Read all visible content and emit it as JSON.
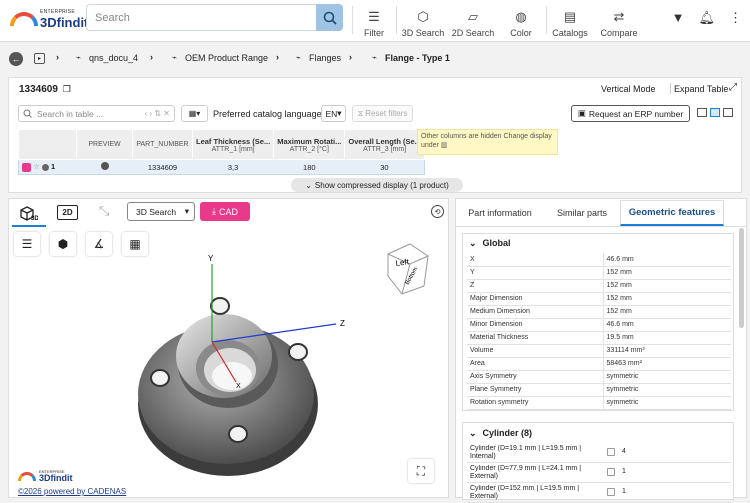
{
  "brand": {
    "enterprise": "ENTERPRISE",
    "name": "3Dfindit"
  },
  "search": {
    "placeholder": "Search"
  },
  "toolbar": {
    "filter": "Filter",
    "search3d": "3D Search",
    "search2d": "2D Search",
    "color": "Color",
    "catalogs": "Catalogs",
    "compare": "Compare"
  },
  "breadcrumb": [
    "qns_docu_4",
    "OEM Product Range",
    "Flanges",
    "Flange - Type 1"
  ],
  "part": {
    "number": "1334609",
    "vertical_mode": "Vertical Mode",
    "expand_table": "Expand Table",
    "search_table_placeholder": "Search in table ...",
    "language_label": "Preferred catalog language",
    "language_value": "EN",
    "reset_filters": "Reset filters",
    "erp_button": "Request an ERP number",
    "hidden_note": "Other columns are hidden Change display under",
    "compressed": "Show compressed display (1 product)"
  },
  "table": {
    "headers": [
      {
        "title": "PREVIEW",
        "sub": ""
      },
      {
        "title": "PART_NUMBER",
        "sub": ""
      },
      {
        "title": "Leaf Thickness (Se...",
        "sub": "ATTR_1 [mm]"
      },
      {
        "title": "Maximum Rotati...",
        "sub": "ATTR_2 [°C]"
      },
      {
        "title": "Overall Length (Se...",
        "sub": "ATTR_3 [mm]"
      }
    ],
    "row": {
      "index": "1",
      "part_number": "1334609",
      "attr1": "3,3",
      "attr2": "180",
      "attr3": "30"
    }
  },
  "viewer": {
    "mode_2d": "2D",
    "search_3d": "3D Search",
    "cad": "CAD",
    "cube_left": "Left",
    "cube_bottom": "Bottom",
    "axis_x": "X",
    "axis_y": "Y",
    "axis_z": "Z",
    "footer_brand": "3Dfindit",
    "footer_enterprise": "ENTERPRISE",
    "powered": "©2026 powered by CADENAS"
  },
  "info_tabs": [
    "Part information",
    "Similar parts",
    "Geometric features"
  ],
  "global": {
    "title": "Global",
    "rows": [
      [
        "X",
        "46.6 mm"
      ],
      [
        "Y",
        "152 mm"
      ],
      [
        "Z",
        "152 mm"
      ],
      [
        "Major Dimension",
        "152 mm"
      ],
      [
        "Medium Dimension",
        "152 mm"
      ],
      [
        "Minor Dimension",
        "46.6 mm"
      ],
      [
        "Material Thickness",
        "19.5 mm"
      ],
      [
        "Volume",
        "331114 mm³"
      ],
      [
        "Area",
        "58463 mm²"
      ],
      [
        "Axis Symmetry",
        "symmetric"
      ],
      [
        "Plane Symmetry",
        "symmetric"
      ],
      [
        "Rotation symmetry",
        "symmetric"
      ]
    ]
  },
  "cylinder": {
    "title": "Cylinder (8)",
    "rows": [
      [
        "Cylinder (D=19.1 mm | L=19.5 mm | Internal)",
        "4"
      ],
      [
        "Cylinder (D=77.9 mm | L=24.1 mm | External)",
        "1"
      ],
      [
        "Cylinder (D=152 mm | L=19.5 mm | External)",
        "1"
      ]
    ]
  },
  "colors": {
    "accent": "#1b7fd4",
    "cad": "#e8398b",
    "tab_active": "#1b7fd4"
  }
}
